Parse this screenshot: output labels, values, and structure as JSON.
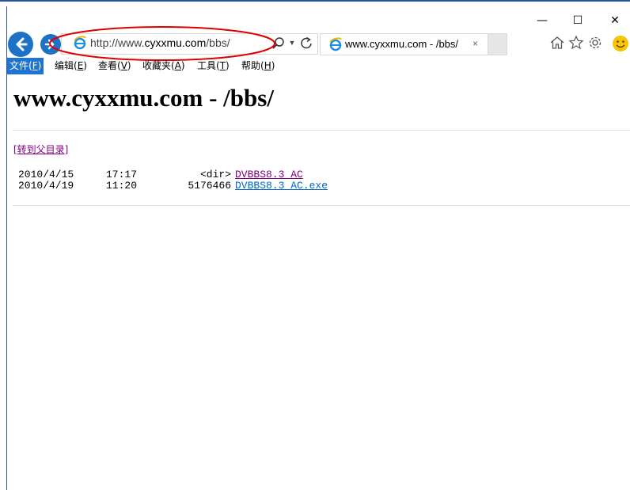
{
  "window": {
    "caption_min": "—",
    "caption_max": "☐",
    "caption_close": "✕"
  },
  "address_bar": {
    "url_prefix": "http://www.",
    "url_domain": "cyxxmu.com",
    "url_path": "/bbs/"
  },
  "tab": {
    "title": "www.cyxxmu.com - /bbs/",
    "close": "×"
  },
  "icons": [
    "back-icon",
    "forward-icon",
    "ie-icon",
    "search-icon",
    "refresh-icon",
    "home-icon",
    "star-icon",
    "gear-icon",
    "smiley-icon"
  ],
  "menu": {
    "items": [
      {
        "label": "文件(",
        "key": "F",
        "tail": ")"
      },
      {
        "label": "编辑(",
        "key": "E",
        "tail": ")"
      },
      {
        "label": "查看(",
        "key": "V",
        "tail": ")"
      },
      {
        "label": "收藏夹(",
        "key": "A",
        "tail": ")"
      },
      {
        "label": "工具(",
        "key": "T",
        "tail": ")"
      },
      {
        "label": "帮助(",
        "key": "H",
        "tail": ")"
      }
    ]
  },
  "page": {
    "heading": "www.cyxxmu.com - /bbs/",
    "parent_link": "[转到父目录]",
    "listing": [
      {
        "date": "2010/4/15",
        "time": "17:17",
        "size": "<dir>",
        "name": "DVBBS8.3_AC"
      },
      {
        "date": "2010/4/19",
        "time": "11:20",
        "size": "5176466",
        "name": "DVBBS8.3_AC.exe"
      }
    ]
  },
  "colors": {
    "accent": "#1e72c6",
    "menu_active": "#1e74d0",
    "visited_link": "#800080",
    "link": "#0066cc",
    "annotation": "#e00000"
  }
}
